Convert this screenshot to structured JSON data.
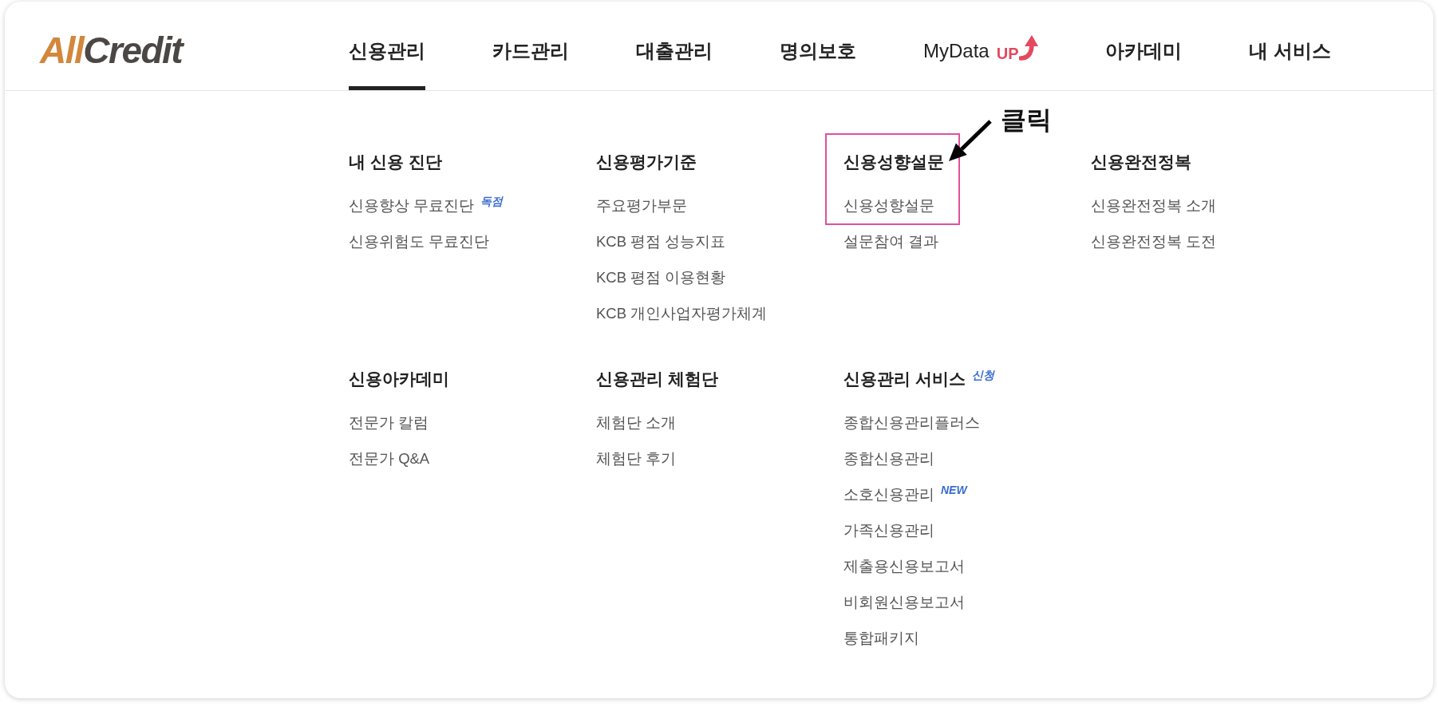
{
  "logo": {
    "accent": "All",
    "rest": "Credit"
  },
  "nav": [
    {
      "label": "신용관리",
      "selected": true
    },
    {
      "label": "카드관리",
      "selected": false
    },
    {
      "label": "대출관리",
      "selected": false
    },
    {
      "label": "명의보호",
      "selected": false
    },
    {
      "label": "MyData",
      "tag": "UP",
      "selected": false
    },
    {
      "label": "아카데미",
      "selected": false
    },
    {
      "label": "내 서비스",
      "selected": false
    }
  ],
  "menu": [
    {
      "heading": "내 신용 진단",
      "highlighted": false,
      "items": [
        {
          "label": "신용향상 무료진단",
          "tag": "독점"
        },
        {
          "label": "신용위험도 무료진단"
        }
      ]
    },
    {
      "heading": "신용평가기준",
      "highlighted": false,
      "items": [
        {
          "label": "주요평가부문"
        },
        {
          "label": "KCB 평점 성능지표"
        },
        {
          "label": "KCB 평점 이용현황"
        },
        {
          "label": "KCB 개인사업자평가체계"
        }
      ]
    },
    {
      "heading": "신용성향설문",
      "highlighted": true,
      "callout": "클릭",
      "items": [
        {
          "label": "신용성향설문"
        },
        {
          "label": "설문참여 결과"
        }
      ]
    },
    {
      "heading": "신용완전정복",
      "highlighted": false,
      "items": [
        {
          "label": "신용완전정복 소개"
        },
        {
          "label": "신용완전정복 도전"
        }
      ]
    },
    {
      "heading": "신용아카데미",
      "highlighted": false,
      "items": [
        {
          "label": "전문가 칼럼"
        },
        {
          "label": "전문가 Q&A"
        }
      ]
    },
    {
      "heading": "신용관리 체험단",
      "highlighted": false,
      "items": [
        {
          "label": "체험단 소개"
        },
        {
          "label": "체험단 후기"
        }
      ]
    },
    {
      "heading": "신용관리 서비스",
      "tag": "신청",
      "highlighted": false,
      "items": [
        {
          "label": "종합신용관리플러스"
        },
        {
          "label": "종합신용관리"
        },
        {
          "label": "소호신용관리",
          "tag": "NEW"
        },
        {
          "label": "가족신용관리"
        },
        {
          "label": "제출용신용보고서"
        },
        {
          "label": "비회원신용보고서"
        },
        {
          "label": "통합패키지"
        }
      ]
    }
  ]
}
